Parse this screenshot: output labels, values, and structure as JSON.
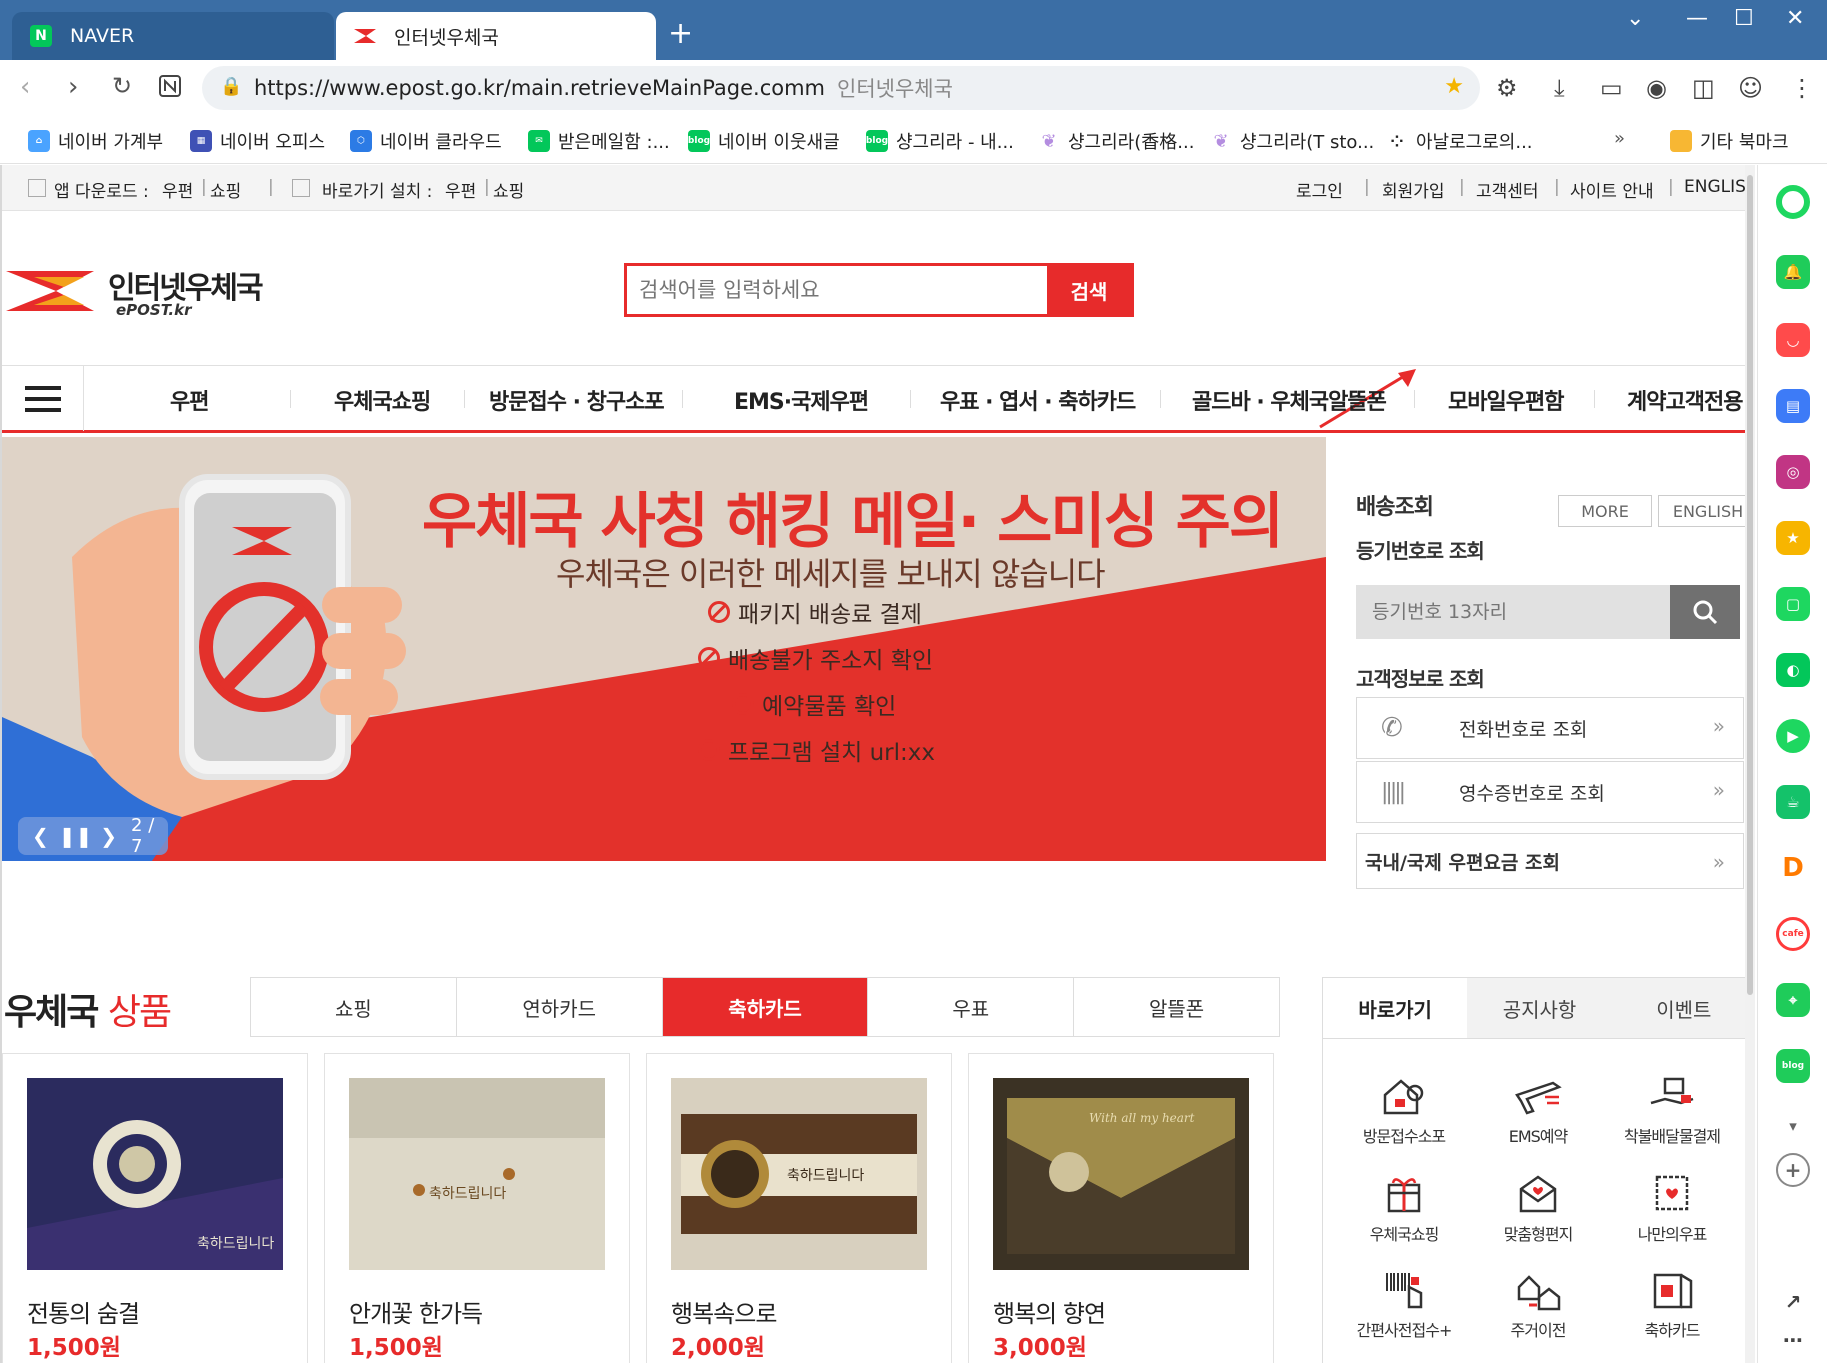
{
  "browser": {
    "tabs": [
      {
        "title": "NAVER",
        "active": false
      },
      {
        "title": "인터넷우체국",
        "active": true
      }
    ],
    "new_tab": "+",
    "url": "https://www.epost.go.kr/main.retrieveMainPage.comm",
    "page_title": "인터넷우체국",
    "bookmarks": [
      "네이버 가계부",
      "네이버 오피스",
      "네이버 클라우드",
      "받은메일함 :...",
      "네이버 이웃새글",
      "샹그리라 - 내...",
      "샹그리라(香格...",
      "샹그리라(T sto...",
      "아날로그로의...",
      "»",
      "기타 북마크"
    ]
  },
  "util": {
    "app_download": "앱 다운로드 :",
    "post": "우편",
    "shopping": "쇼핑",
    "shortcut_install": "바로가기 설치 :",
    "login": "로그인",
    "signup": "회원가입",
    "support": "고객센터",
    "site_guide": "사이트 안내",
    "english": "ENGLISH"
  },
  "logo": {
    "name": "인터넷우체국",
    "sub": "ePOST.kr"
  },
  "search": {
    "placeholder": "검색어를 입력하세요",
    "button": "검색"
  },
  "gnb": [
    "우편",
    "우체국쇼핑",
    "방문접수 · 창구소포",
    "EMS·국제우편",
    "우표 · 엽서 · 축하카드",
    "골드바 · 우체국알뜰폰",
    "모바일우편함",
    "계약고객전용"
  ],
  "banner": {
    "title": "우체국 사칭 해킹 메일· 스미싱 주의",
    "subtitle": "우체국은 이러한 메세지를 보내지 않습니다",
    "items": [
      "패키지 배송료 결제",
      "배송불가 주소지 확인",
      "예약물품 확인",
      "프로그램 설치 url:xx"
    ],
    "counter": "2 / 7"
  },
  "delivery": {
    "title": "배송조회",
    "more": "MORE",
    "english": "ENGLISH",
    "by_number": "등기번호로 조회",
    "placeholder": "등기번호 13자리",
    "by_customer": "고객정보로 조회",
    "phone": "전화번호로 조회",
    "receipt": "영수증번호로 조회",
    "rates": "국내/국제 우편요금 조회"
  },
  "products": {
    "title_main": "우체국",
    "title_accent": "상품",
    "tabs": [
      "쇼핑",
      "연하카드",
      "축하카드",
      "우표",
      "알뜰폰"
    ],
    "active_tab": "축하카드",
    "items": [
      {
        "name": "전통의 숨결",
        "price": "1,500원"
      },
      {
        "name": "안개꽃 한가득",
        "price": "1,500원"
      },
      {
        "name": "행복속으로",
        "price": "2,000원"
      },
      {
        "name": "행복의 향연",
        "price": "3,000원"
      }
    ]
  },
  "quick": {
    "tabs": [
      "바로가기",
      "공지사항",
      "이벤트"
    ],
    "items": [
      "방문접수소포",
      "EMS예약",
      "착불배달물결제",
      "우체국쇼핑",
      "맞춤형편지",
      "나만의우표",
      "간편사전접수+",
      "주거이전",
      "축하카드"
    ]
  },
  "colors": {
    "brand_red": "#e72b2b",
    "tabbar": "#3b6ea5"
  }
}
